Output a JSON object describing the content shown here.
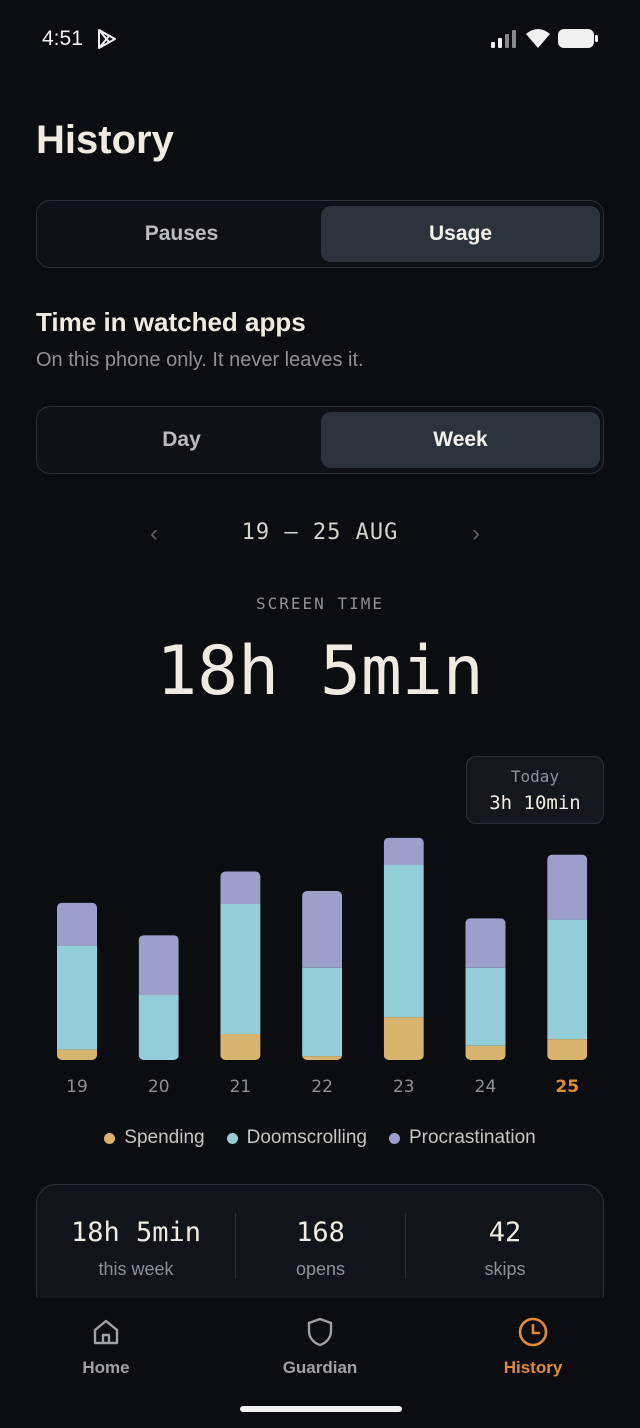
{
  "status_bar": {
    "time": "4:51"
  },
  "page": {
    "title": "History"
  },
  "view_toggle": {
    "options": [
      "Pauses",
      "Usage"
    ],
    "selected": "Usage"
  },
  "section": {
    "title": "Time in watched apps",
    "subtitle": "On this phone only. It never leaves it."
  },
  "period_toggle": {
    "options": [
      "Day",
      "Week"
    ],
    "selected": "Week"
  },
  "range": {
    "label": "19 – 25 AUG",
    "prev_icon": "‹",
    "next_icon": "›"
  },
  "screen_time": {
    "label": "SCREEN TIME",
    "value": "18h 5min"
  },
  "tooltip": {
    "label": "Today",
    "value": "3h 10min"
  },
  "colors": {
    "spending": "#d9b46e",
    "doomscrolling": "#93cdd8",
    "procrastination": "#9b9fca",
    "accent": "#e08a3c"
  },
  "chart_data": {
    "type": "bar",
    "stacked": true,
    "categories": [
      "19",
      "20",
      "21",
      "22",
      "23",
      "24",
      "25"
    ],
    "highlighted_category": "25",
    "unit": "minutes",
    "series": [
      {
        "name": "Spending",
        "values": [
          8,
          0,
          20,
          3,
          33,
          11,
          16
        ]
      },
      {
        "name": "Doomscrolling",
        "values": [
          80,
          50,
          100,
          68,
          117,
          60,
          92
        ]
      },
      {
        "name": "Procrastination",
        "values": [
          33,
          46,
          25,
          59,
          21,
          38,
          50
        ]
      }
    ]
  },
  "legend": [
    "Spending",
    "Doomscrolling",
    "Procrastination"
  ],
  "stats": [
    {
      "value": "18h 5min",
      "label": "this week"
    },
    {
      "value": "168",
      "label": "opens"
    },
    {
      "value": "42",
      "label": "skips"
    }
  ],
  "tabs": [
    {
      "label": "Home",
      "icon": "home-icon"
    },
    {
      "label": "Guardian",
      "icon": "shield-icon"
    },
    {
      "label": "History",
      "icon": "clock-icon",
      "active": true
    }
  ]
}
